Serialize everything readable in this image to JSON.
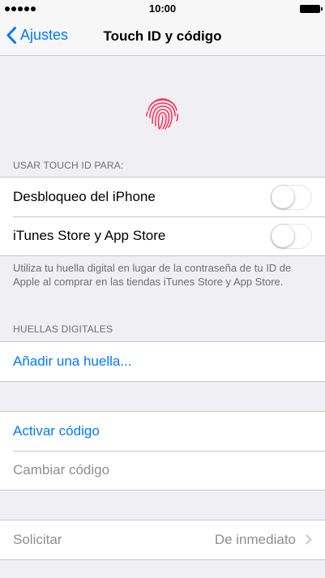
{
  "status_bar": {
    "time": "10:00"
  },
  "nav": {
    "back_label": "Ajustes",
    "title": "Touch ID y código"
  },
  "touch_id_section": {
    "header": "USAR TOUCH ID PARA:",
    "rows": [
      {
        "label": "Desbloqueo del iPhone",
        "toggle": "off"
      },
      {
        "label": "iTunes Store y App Store",
        "toggle": "off"
      }
    ],
    "footer": "Utiliza tu huella digital en lugar de la contraseña de tu ID de Apple al comprar en las tiendas iTunes Store y App Store."
  },
  "fingerprints_section": {
    "header": "HUELLAS DIGITALES",
    "add_label": "Añadir una huella..."
  },
  "passcode_section": {
    "activate_label": "Activar código",
    "change_label": "Cambiar código"
  },
  "require_section": {
    "label": "Solicitar",
    "value": "De inmediato"
  },
  "colors": {
    "accent": "#007aff",
    "fingerprint": "#ff2d55",
    "background": "#efeff4"
  }
}
